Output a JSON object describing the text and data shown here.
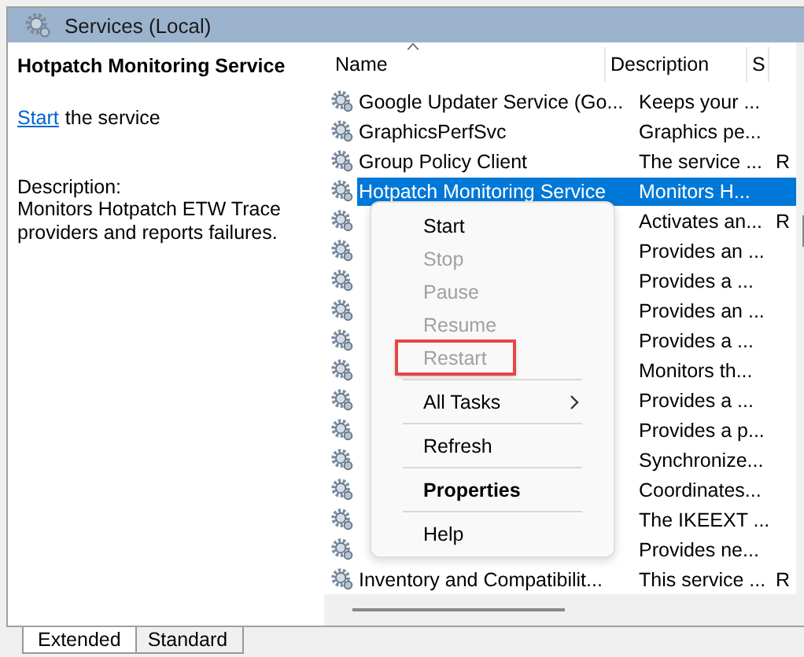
{
  "title_bar": {
    "title": "Services (Local)"
  },
  "detail": {
    "service_name": "Hotpatch Monitoring Service",
    "action_link": "Start",
    "action_text": "the service",
    "description_label": "Description:",
    "description": "Monitors Hotpatch ETW Trace providers and reports failures."
  },
  "table": {
    "columns": [
      "Name",
      "Description",
      "S"
    ],
    "rows": [
      {
        "name": "Google Updater Service (Go...",
        "description": "Keeps your ...",
        "selected": false
      },
      {
        "name": "GraphicsPerfSvc",
        "description": "Graphics pe...",
        "selected": false
      },
      {
        "name": "Group Policy Client",
        "description": "The service ...",
        "status": "R",
        "selected": false
      },
      {
        "name": "Hotpatch Monitoring Service",
        "description": "Monitors H...",
        "selected": true
      },
      {
        "description": "Activates an...",
        "status": "R",
        "selected": false
      },
      {
        "description": "Provides an ...",
        "selected": false
      },
      {
        "description": "Provides a ...",
        "selected": false
      },
      {
        "description": "Provides an ...",
        "selected": false
      },
      {
        "description": "Provides a ...",
        "selected": false
      },
      {
        "description": "Monitors th...",
        "selected": false
      },
      {
        "description": "Provides a ...",
        "selected": false
      },
      {
        "description": "Provides a p...",
        "selected": false
      },
      {
        "description": "Synchronize...",
        "selected": false
      },
      {
        "description": "Coordinates...",
        "selected": false
      },
      {
        "description": "The IKEEXT ...",
        "selected": false
      },
      {
        "description": "Provides ne...",
        "selected": false
      },
      {
        "name": "Inventory and Compatibilit...",
        "description": "This service ...",
        "status": "R",
        "selected": false
      }
    ]
  },
  "context_menu": {
    "items": [
      {
        "kind": "item",
        "label": "Start",
        "disabled": false
      },
      {
        "kind": "item",
        "label": "Stop",
        "disabled": true
      },
      {
        "kind": "item",
        "label": "Pause",
        "disabled": true
      },
      {
        "kind": "item",
        "label": "Resume",
        "disabled": true
      },
      {
        "kind": "item",
        "label": "Restart",
        "disabled": true,
        "highlighted": true
      },
      {
        "kind": "separator"
      },
      {
        "kind": "submenu",
        "label": "All Tasks",
        "disabled": false
      },
      {
        "kind": "separator"
      },
      {
        "kind": "item",
        "label": "Refresh",
        "disabled": false
      },
      {
        "kind": "separator"
      },
      {
        "kind": "item",
        "label": "Properties",
        "disabled": false,
        "bold": true
      },
      {
        "kind": "separator"
      },
      {
        "kind": "item",
        "label": "Help",
        "disabled": false
      }
    ]
  },
  "tabs": [
    {
      "label": "Extended",
      "selected": true
    },
    {
      "label": "Standard",
      "selected": false
    }
  ]
}
